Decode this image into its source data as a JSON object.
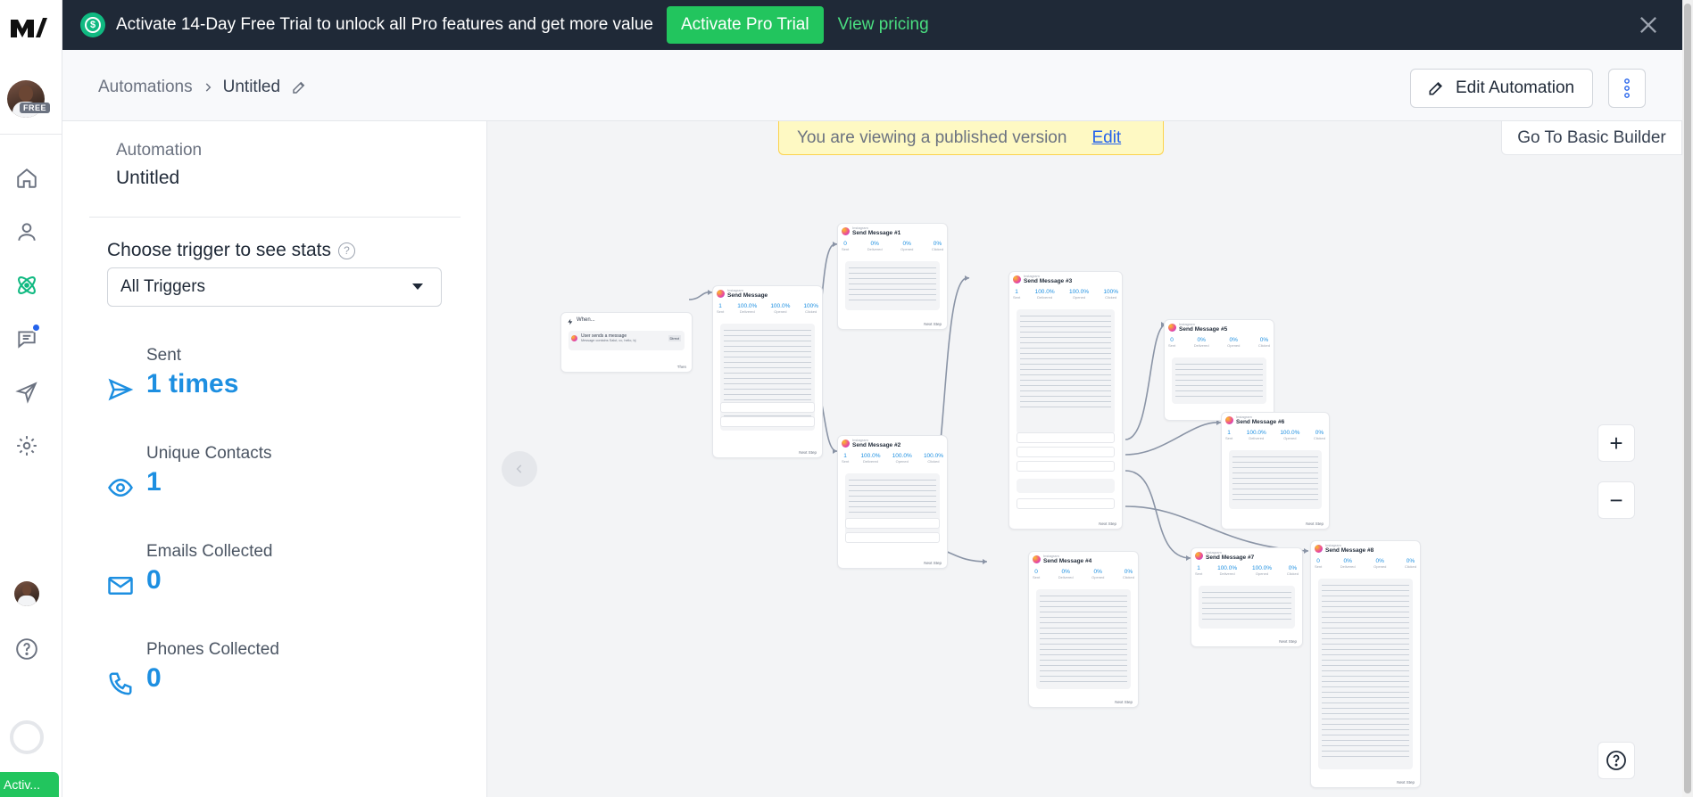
{
  "banner": {
    "message": "Activate 14-Day Free Trial to unlock all Pro features and get more value",
    "trial_button": "Activate Pro Trial",
    "pricing_link": "View pricing"
  },
  "rail": {
    "logo": "m",
    "plan_badge": "FREE",
    "nav": [
      "home-icon",
      "contacts-icon",
      "automations-icon",
      "chat-icon",
      "broadcast-icon",
      "settings-icon"
    ],
    "bottom_button": "Activ..."
  },
  "header": {
    "breadcrumb_root": "Automations",
    "breadcrumb_current": "Untitled",
    "edit_button": "Edit Automation"
  },
  "panel": {
    "automation_label": "Automation",
    "automation_name": "Untitled",
    "choose_trigger": "Choose trigger to see stats",
    "trigger_select": "All Triggers",
    "stats": [
      {
        "label": "Sent",
        "value": "1 times",
        "icon": "send-icon"
      },
      {
        "label": "Unique Contacts",
        "value": "1",
        "icon": "eye-icon"
      },
      {
        "label": "Emails Collected",
        "value": "0",
        "icon": "mail-icon"
      },
      {
        "label": "Phones Collected",
        "value": "0",
        "icon": "phone-icon"
      }
    ]
  },
  "canvas": {
    "published_notice": "You are viewing a published version",
    "edit_link": "Edit",
    "basic_builder": "Go To Basic Builder",
    "zoom_in": "+",
    "zoom_out": "−",
    "nodes": {
      "trigger": {
        "title": "When...",
        "trigger_text": "User sends a message",
        "trigger_sub": "Message contains Salut, cc, hello, bj",
        "tag": "Direct",
        "then": "Then"
      },
      "n1": {
        "sub": "Instagram",
        "title": "Send Message"
      },
      "n2": {
        "sub": "Instagram",
        "title": "Send Message #1"
      },
      "n3": {
        "sub": "Instagram",
        "title": "Send Message #2"
      },
      "n4": {
        "sub": "Instagram",
        "title": "Send Message #3"
      },
      "n5": {
        "sub": "Instagram",
        "title": "Send Message #4"
      },
      "n6": {
        "sub": "Instagram",
        "title": "Send Message #5"
      },
      "n7": {
        "sub": "Instagram",
        "title": "Send Message #6"
      },
      "n8": {
        "sub": "Instagram",
        "title": "Send Message #7"
      },
      "n9": {
        "sub": "Instagram",
        "title": "Send Message #8"
      },
      "stat_labels": [
        "Sent",
        "Delivered",
        "Opened",
        "Clicked"
      ],
      "next_step": "Next Step"
    }
  }
}
